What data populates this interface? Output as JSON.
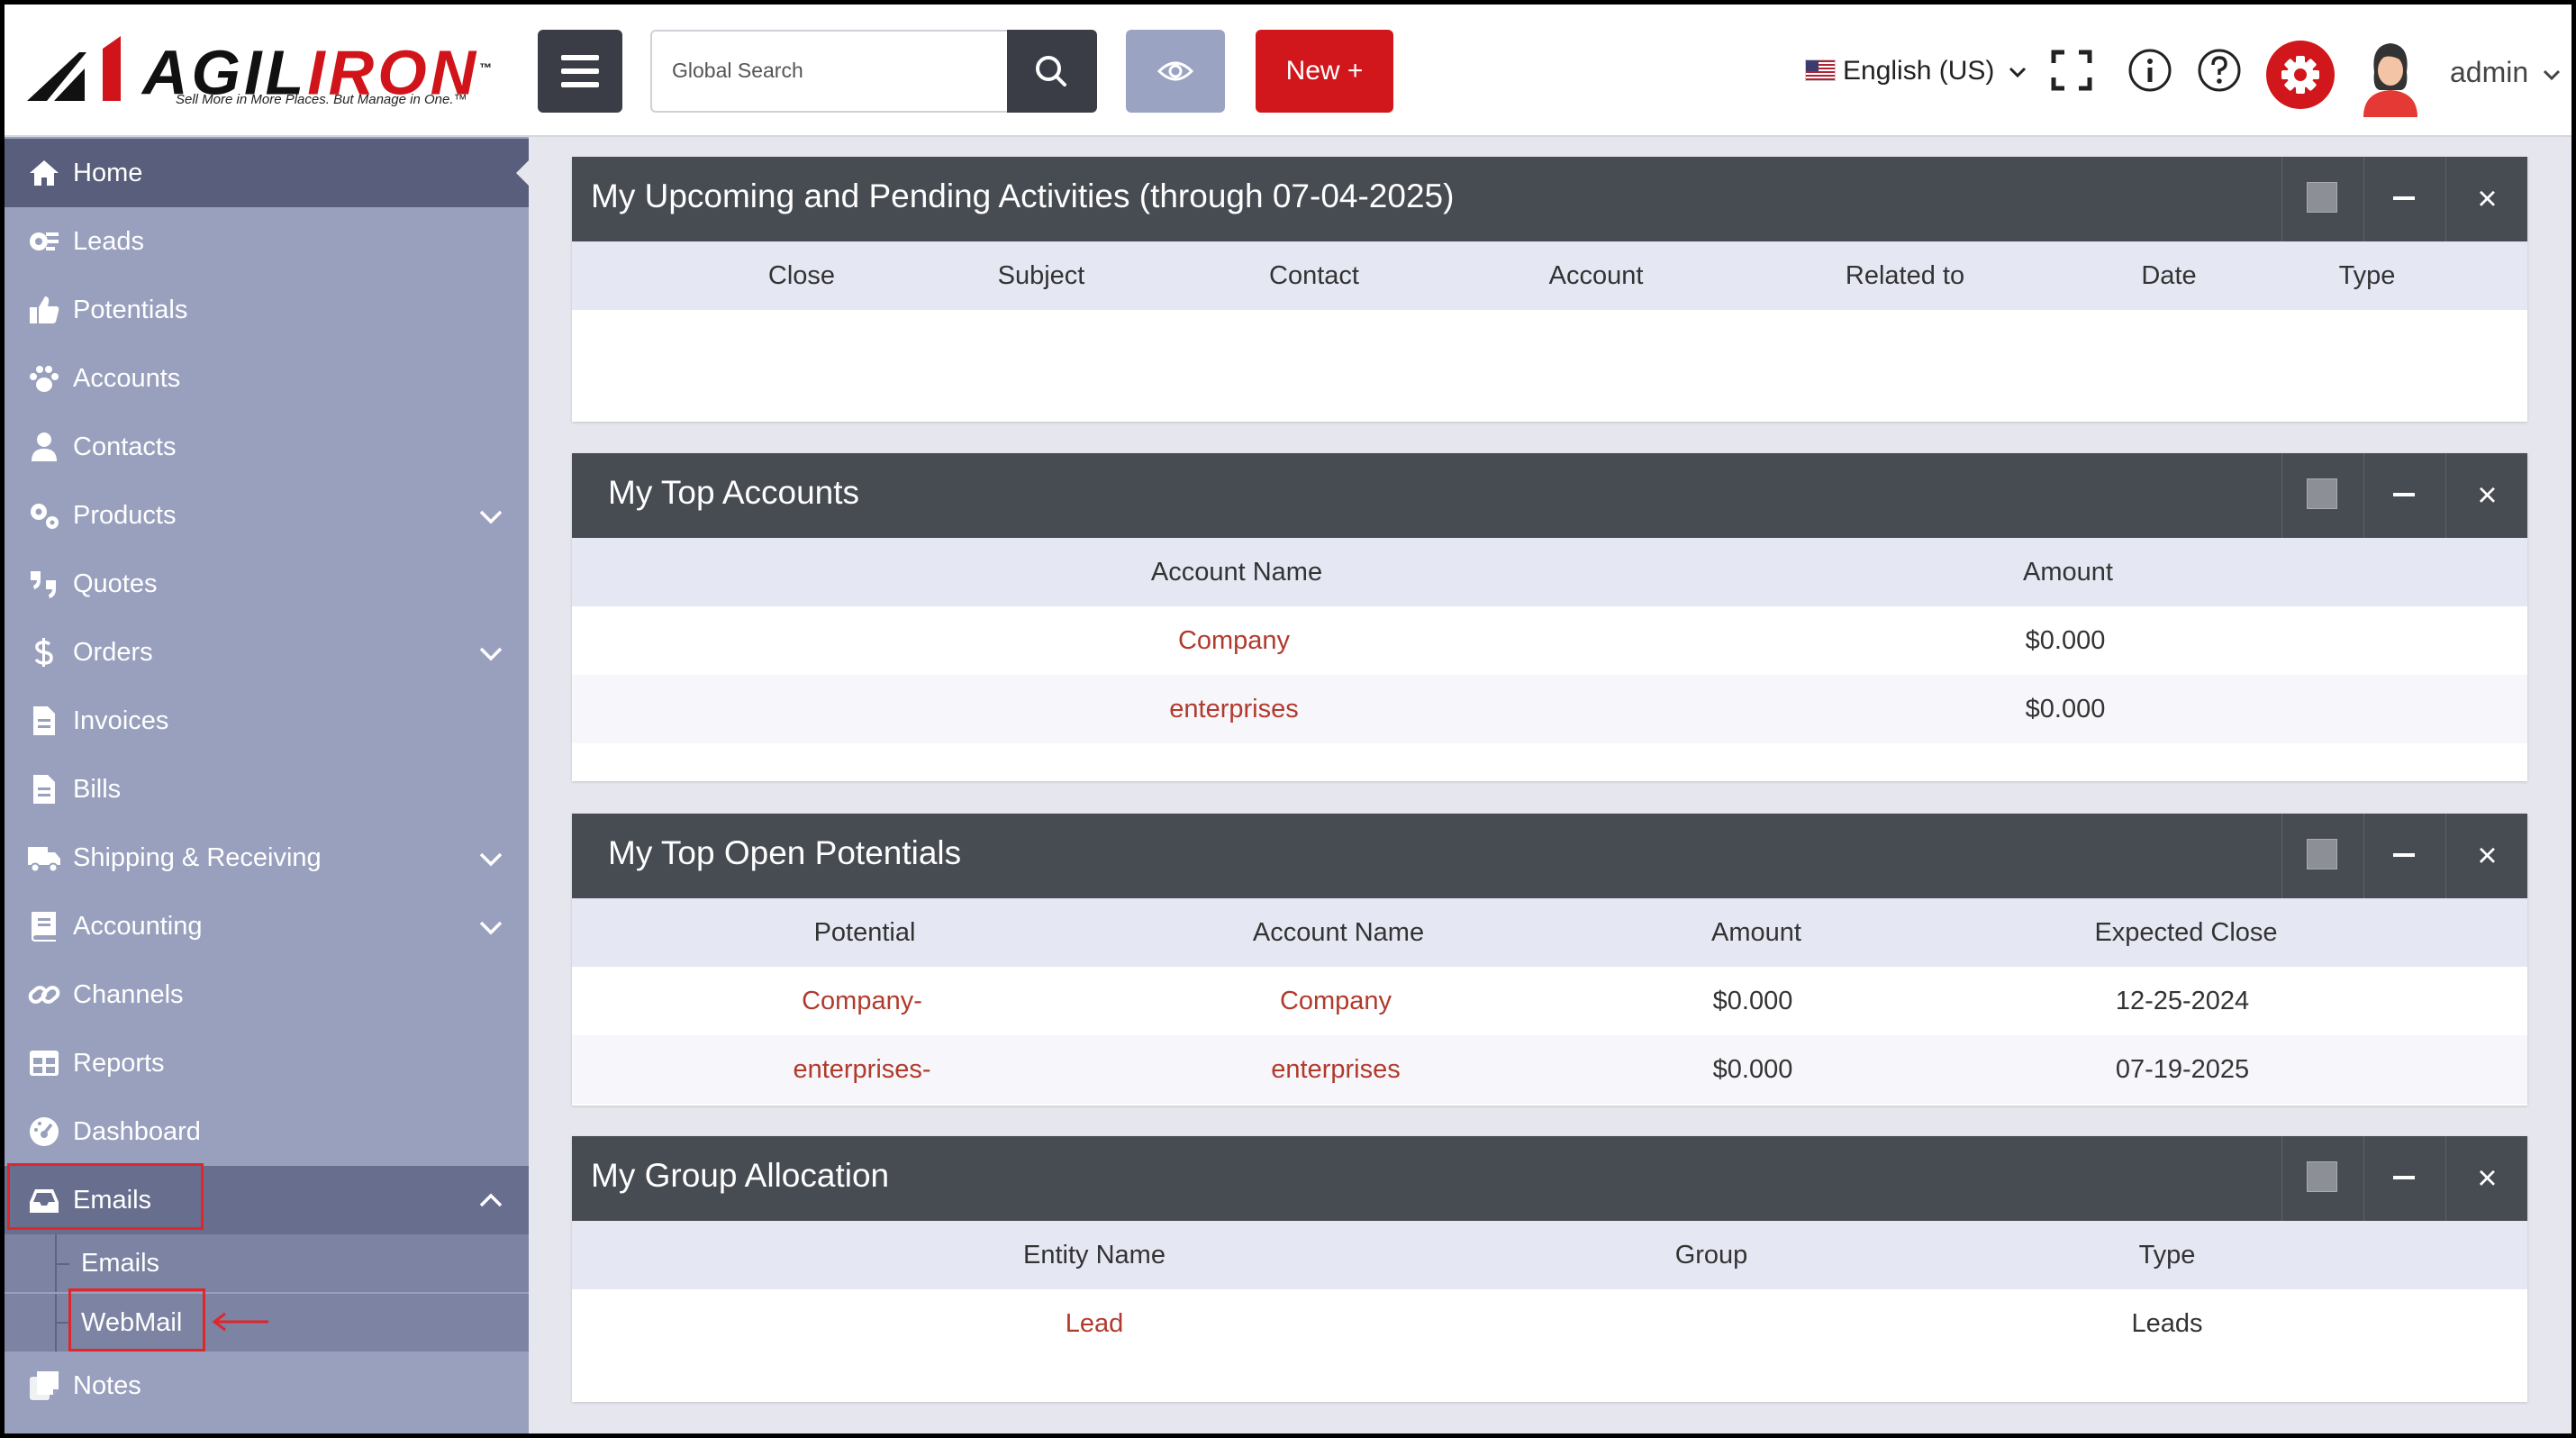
{
  "header": {
    "logo_name_a": "AGIL",
    "logo_name_b": "IRON",
    "logo_tm": "™",
    "logo_tagline": "Sell More in More Places. But Manage in One.™",
    "search_placeholder": "Global Search",
    "new_button": "New +",
    "language": "English (US)",
    "user": "admin"
  },
  "sidebar": {
    "items": [
      {
        "label": "Home",
        "icon": "home-icon"
      },
      {
        "label": "Leads",
        "icon": "leads-icon"
      },
      {
        "label": "Potentials",
        "icon": "thumbs-up-icon"
      },
      {
        "label": "Accounts",
        "icon": "paw-icon"
      },
      {
        "label": "Contacts",
        "icon": "user-icon"
      },
      {
        "label": "Products",
        "icon": "cogs-icon"
      },
      {
        "label": "Quotes",
        "icon": "quote-icon"
      },
      {
        "label": "Orders",
        "icon": "dollar-icon"
      },
      {
        "label": "Invoices",
        "icon": "file-icon"
      },
      {
        "label": "Bills",
        "icon": "file-icon"
      },
      {
        "label": "Shipping & Receiving",
        "icon": "truck-icon"
      },
      {
        "label": "Accounting",
        "icon": "book-icon"
      },
      {
        "label": "Channels",
        "icon": "link-icon"
      },
      {
        "label": "Reports",
        "icon": "table-icon"
      },
      {
        "label": "Dashboard",
        "icon": "gauge-icon"
      },
      {
        "label": "Emails",
        "icon": "inbox-icon"
      },
      {
        "label": "Notes",
        "icon": "notes-icon"
      }
    ],
    "sub_items": [
      "Emails",
      "WebMail"
    ]
  },
  "panels": {
    "activities": {
      "title": "My Upcoming and Pending Activities (through 07-04-2025)",
      "columns": [
        "Close",
        "Subject",
        "Contact",
        "Account",
        "Related to",
        "Date",
        "Type"
      ]
    },
    "top_accounts": {
      "title": "My Top Accounts",
      "columns": [
        "Account Name",
        "Amount"
      ],
      "rows": [
        {
          "name": "Company",
          "amount": "$0.000"
        },
        {
          "name": "enterprises",
          "amount": "$0.000"
        }
      ]
    },
    "potentials": {
      "title": "My Top Open Potentials",
      "columns": [
        "Potential",
        "Account Name",
        "Amount",
        "Expected Close"
      ],
      "rows": [
        {
          "potential": "Company-",
          "account": "Company",
          "amount": "$0.000",
          "close": "12-25-2024"
        },
        {
          "potential": "enterprises-",
          "account": "enterprises",
          "amount": "$0.000",
          "close": "07-19-2025"
        }
      ]
    },
    "groups": {
      "title": "My Group Allocation",
      "columns": [
        "Entity Name",
        "Group",
        "Type"
      ],
      "rows": [
        {
          "entity": "Lead",
          "group": "",
          "type": "Leads"
        }
      ]
    }
  },
  "colors": {
    "brand_red": "#d1171b",
    "sidebar": "#99a0bd",
    "panel_header": "#474b52",
    "link": "#b23a2c"
  }
}
